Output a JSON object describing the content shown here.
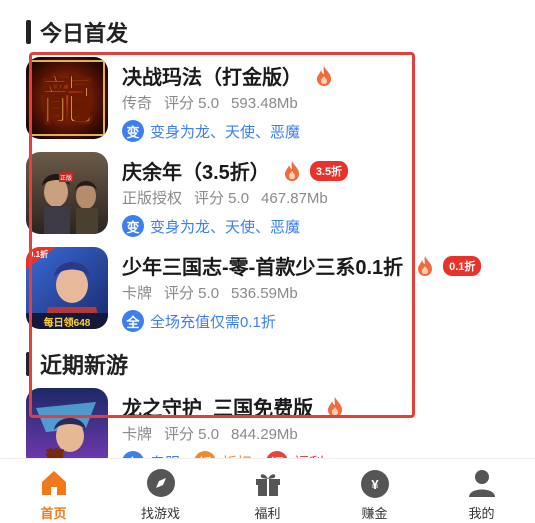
{
  "sections": {
    "today": "今日首发",
    "recent": "近期新游"
  },
  "games": [
    {
      "name": "决战玛法（打金版）",
      "genre": "传奇",
      "rating": "评分 5.0",
      "size": "593.48Mb",
      "discount": "",
      "tags": [
        {
          "badge": "变",
          "text": "变身为龙、天使、恶魔",
          "color": "#3b7ff0"
        }
      ]
    },
    {
      "name": "庆余年（3.5折）",
      "genre": "正版授权",
      "rating": "评分 5.0",
      "size": "467.87Mb",
      "discount": "3.5折",
      "tags": [
        {
          "badge": "变",
          "text": "变身为龙、天使、恶魔",
          "color": "#3b7ff0"
        }
      ]
    },
    {
      "name": "少年三国志-零-首款少三系0.1折",
      "genre": "卡牌",
      "rating": "评分 5.0",
      "size": "536.59Mb",
      "discount": "0.1折",
      "tags": [
        {
          "badge": "全",
          "text": "全场充值仅需0.1折",
          "color": "#3b7ff0"
        }
      ]
    },
    {
      "name": "龙之守护_三国免费版",
      "genre": "卡牌",
      "rating": "评分 5.0",
      "size": "844.29Mb",
      "discount": "",
      "tags": [
        {
          "badge": "专",
          "text": "专服",
          "color": "#3b7ff0"
        },
        {
          "badge": "折",
          "text": "折扣",
          "color": "#f08a2a"
        },
        {
          "badge": "福",
          "text": "福利",
          "color": "#e8443a"
        }
      ]
    }
  ],
  "tabs": [
    {
      "label": "首页",
      "icon": "home-icon",
      "active": true
    },
    {
      "label": "找游戏",
      "icon": "compass-icon",
      "active": false
    },
    {
      "label": "福利",
      "icon": "gift-icon",
      "active": false
    },
    {
      "label": "赚金",
      "icon": "money-bag-icon",
      "active": false
    },
    {
      "label": "我的",
      "icon": "user-icon",
      "active": false
    }
  ],
  "colors": {
    "accent": "#f07a1a",
    "highlight_border": "#e0413a",
    "discount_badge": "#e8332a",
    "tag_blue": "#3b7ff0"
  }
}
